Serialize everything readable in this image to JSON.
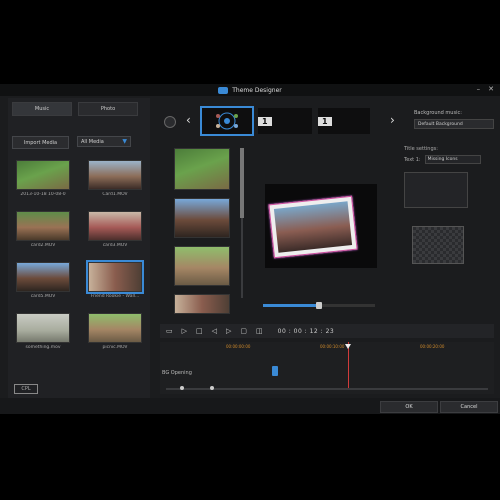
{
  "window": {
    "title": "Theme Designer"
  },
  "library": {
    "tabs": [
      "Music",
      "Photo"
    ],
    "import_label": "Import Media",
    "filter_label": "All Media",
    "items": [
      {
        "caption": "2013-10-18 10-08-0",
        "fill": "t1"
      },
      {
        "caption": "Card1.MOV",
        "fill": "t2"
      },
      {
        "caption": "card2.MOV",
        "fill": "t3"
      },
      {
        "caption": "card3.MOV",
        "fill": "t4"
      },
      {
        "caption": "card5.MOV",
        "fill": "t5"
      },
      {
        "caption": "Friend Rookie - Wall...",
        "fill": "t6"
      },
      {
        "caption": "something.mov",
        "fill": "t7"
      },
      {
        "caption": "picnic.MOV",
        "fill": "t8"
      }
    ],
    "logo": "CPL"
  },
  "carousel": {
    "themes": [
      "",
      "1",
      "1"
    ],
    "bg_music_label": "Background music:",
    "bg_music_value": "Default Background"
  },
  "settings": {
    "title_label": "Title settings:",
    "text_label": "Text 1:",
    "text_value": "Missing Icons"
  },
  "preview": {
    "progress": 0.5
  },
  "transport": {
    "time": "00 : 00 : 12 : 23"
  },
  "timeline": {
    "ticks": [
      "00:00:00:00",
      "00:00:10:00",
      "00:00:20:00"
    ],
    "track_label": "BG Opening"
  },
  "footer": {
    "ok": "OK",
    "cancel": "Cancel"
  }
}
